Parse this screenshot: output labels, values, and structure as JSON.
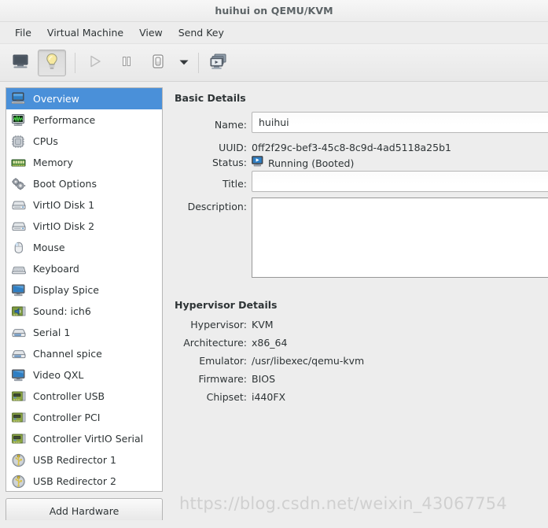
{
  "window": {
    "title": "huihui on QEMU/KVM"
  },
  "menubar": {
    "items": [
      {
        "label": "File"
      },
      {
        "label": "Virtual Machine"
      },
      {
        "label": "View"
      },
      {
        "label": "Send Key"
      }
    ]
  },
  "toolbar": {
    "buttons": [
      {
        "name": "console-view-icon",
        "icon": "monitor",
        "pressed": false,
        "enabled": true
      },
      {
        "name": "details-view-icon",
        "icon": "lightbulb",
        "pressed": true,
        "enabled": true
      },
      {
        "name": "run-icon",
        "icon": "play",
        "pressed": false,
        "enabled": false
      },
      {
        "name": "pause-icon",
        "icon": "pause",
        "pressed": false,
        "enabled": true
      },
      {
        "name": "shutdown-icon",
        "icon": "power",
        "pressed": false,
        "enabled": true
      },
      {
        "name": "shutdown-dropdown-icon",
        "icon": "chevron-down",
        "pressed": false,
        "enabled": true
      },
      {
        "name": "snapshots-icon",
        "icon": "snapshots",
        "pressed": false,
        "enabled": true
      }
    ]
  },
  "sidebar": {
    "items": [
      {
        "label": "Overview",
        "icon": "computer-icon",
        "selected": true
      },
      {
        "label": "Performance",
        "icon": "performance-graph-icon",
        "selected": false
      },
      {
        "label": "CPUs",
        "icon": "cpu-chip-icon",
        "selected": false
      },
      {
        "label": "Memory",
        "icon": "memory-stick-icon",
        "selected": false
      },
      {
        "label": "Boot Options",
        "icon": "gears-icon",
        "selected": false
      },
      {
        "label": "VirtIO Disk 1",
        "icon": "hard-disk-icon",
        "selected": false
      },
      {
        "label": "VirtIO Disk 2",
        "icon": "hard-disk-icon",
        "selected": false
      },
      {
        "label": "Mouse",
        "icon": "mouse-icon",
        "selected": false
      },
      {
        "label": "Keyboard",
        "icon": "keyboard-icon",
        "selected": false
      },
      {
        "label": "Display Spice",
        "icon": "display-icon",
        "selected": false
      },
      {
        "label": "Sound: ich6",
        "icon": "sound-card-icon",
        "selected": false
      },
      {
        "label": "Serial 1",
        "icon": "serial-port-icon",
        "selected": false
      },
      {
        "label": "Channel spice",
        "icon": "serial-port-icon",
        "selected": false
      },
      {
        "label": "Video QXL",
        "icon": "display-icon",
        "selected": false
      },
      {
        "label": "Controller USB",
        "icon": "controller-card-icon",
        "selected": false
      },
      {
        "label": "Controller PCI",
        "icon": "controller-card-icon",
        "selected": false
      },
      {
        "label": "Controller VirtIO Serial",
        "icon": "controller-card-icon",
        "selected": false
      },
      {
        "label": "USB Redirector 1",
        "icon": "usb-icon",
        "selected": false
      },
      {
        "label": "USB Redirector 2",
        "icon": "usb-icon",
        "selected": false
      }
    ],
    "add_hardware_label": "Add Hardware"
  },
  "basic_details": {
    "section_title": "Basic Details",
    "name_label": "Name:",
    "name_value": "huihui",
    "uuid_label": "UUID:",
    "uuid_value": "0ff2f29c-bef3-45c8-8c9d-4ad5118a25b1",
    "status_label": "Status:",
    "status_value": "Running (Booted)",
    "status_icon": "running-monitor-icon",
    "title_label": "Title:",
    "title_value": "",
    "description_label": "Description:",
    "description_value": ""
  },
  "hypervisor_details": {
    "section_title": "Hypervisor Details",
    "rows": [
      {
        "label": "Hypervisor:",
        "value": "KVM"
      },
      {
        "label": "Architecture:",
        "value": "x86_64"
      },
      {
        "label": "Emulator:",
        "value": "/usr/libexec/qemu-kvm"
      },
      {
        "label": "Firmware:",
        "value": "BIOS"
      },
      {
        "label": "Chipset:",
        "value": "i440FX"
      }
    ]
  },
  "watermark": {
    "text": "https://blog.csdn.net/weixin_43067754"
  },
  "colors": {
    "selection": "#4a90d9",
    "window_bg": "#ededed",
    "text": "#2e3436",
    "title_text": "#5c6366"
  }
}
